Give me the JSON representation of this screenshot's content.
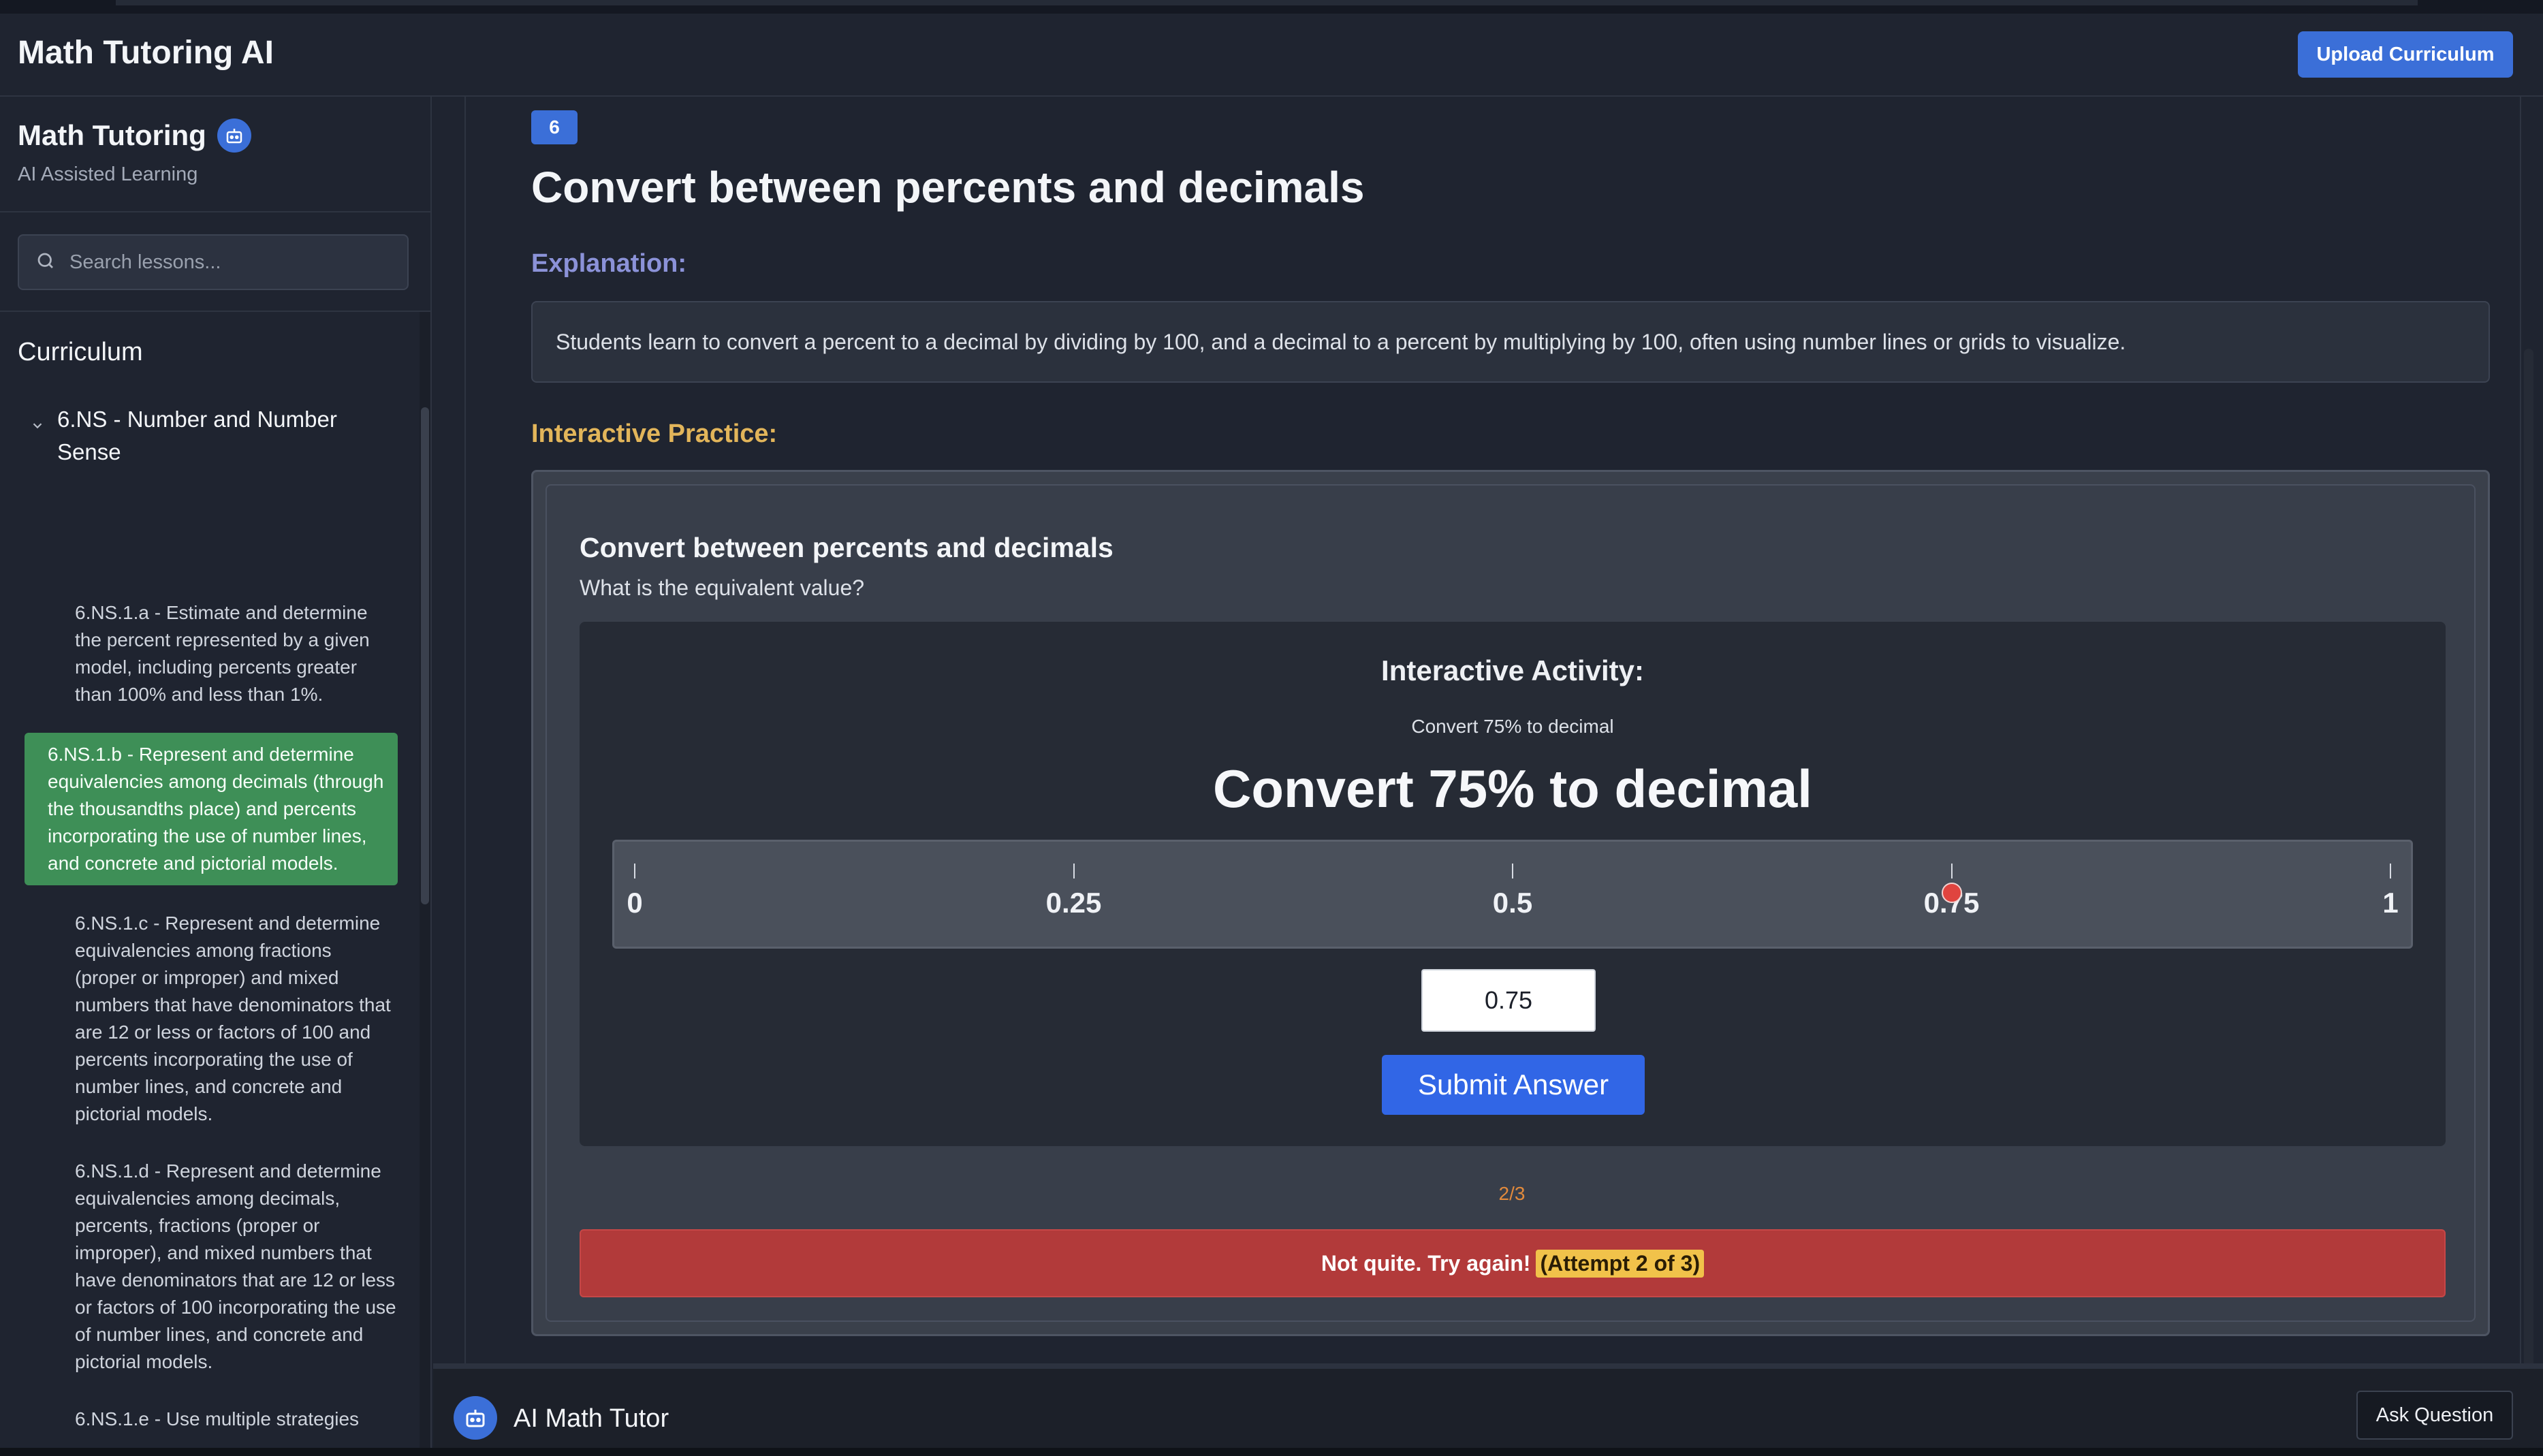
{
  "app": {
    "title": "Math Tutoring AI",
    "upload_label": "Upload Curriculum"
  },
  "sidebar": {
    "brand_title": "Math Tutoring",
    "brand_subtitle": "AI Assisted Learning",
    "search_placeholder": "Search lessons...",
    "curriculum_heading": "Curriculum",
    "domain_label": "6.NS - Number and Number Sense",
    "lessons": [
      {
        "label": "6.NS.1.a - Estimate and determine the percent represented by a given model, including percents greater than 100% and less than 1%."
      },
      {
        "label": "6.NS.1.b - Represent and determine equivalencies among decimals (through the thousandths place) and percents incorporating the use of number lines, and concrete and pictorial models."
      },
      {
        "label": "6.NS.1.c - Represent and determine equivalencies among fractions (proper or improper) and mixed numbers that have denominators that are 12 or less or factors of 100 and percents incorporating the use of number lines, and concrete and pictorial models."
      },
      {
        "label": "6.NS.1.d - Represent and determine equivalencies among decimals, percents, fractions (proper or improper), and mixed numbers that have denominators that are 12 or less or factors of 100 incorporating the use of number lines, and concrete and pictorial models."
      },
      {
        "label": "6.NS.1.e - Use multiple strategies"
      }
    ],
    "active_lesson_index": 1
  },
  "main": {
    "lesson_number": "6",
    "lesson_title": "Convert between percents and decimals",
    "explanation_label": "Explanation:",
    "explanation_text": "Students learn to convert a percent to a decimal by dividing by 100, and a decimal to a percent by multiplying by 100, often using number lines or grids to visualize.",
    "practice_label": "Interactive Practice:",
    "practice": {
      "title": "Convert between percents and decimals",
      "question": "What is the equivalent value?",
      "activity_heading": "Interactive Activity:",
      "activity_subtitle": "Convert 75% to decimal",
      "activity_prompt": "Convert 75% to decimal",
      "number_line": {
        "ticks": [
          "0",
          "0.25",
          "0.5",
          "0.75",
          "1"
        ],
        "min": 0,
        "max": 1,
        "marker_value": 0.75
      },
      "answer_value": "0.75",
      "submit_label": "Submit Answer",
      "progress": "2/3",
      "feedback_text": "Not quite. Try again!",
      "feedback_attempt": "(Attempt 2 of 3)"
    }
  },
  "tutor": {
    "name": "AI Math Tutor",
    "ask_label": "Ask Question"
  },
  "colors": {
    "accent": "#3b6fd8",
    "active_lesson": "#3e8f57",
    "explanation_label": "#8b92d8",
    "practice_label": "#e2b55a",
    "feedback_bg": "#b23a3a",
    "marker": "#e0443f"
  },
  "icons": {
    "brand": "robot-icon",
    "search": "search-icon",
    "domain_toggle": "chevron-down-icon",
    "tutor": "robot-icon"
  }
}
